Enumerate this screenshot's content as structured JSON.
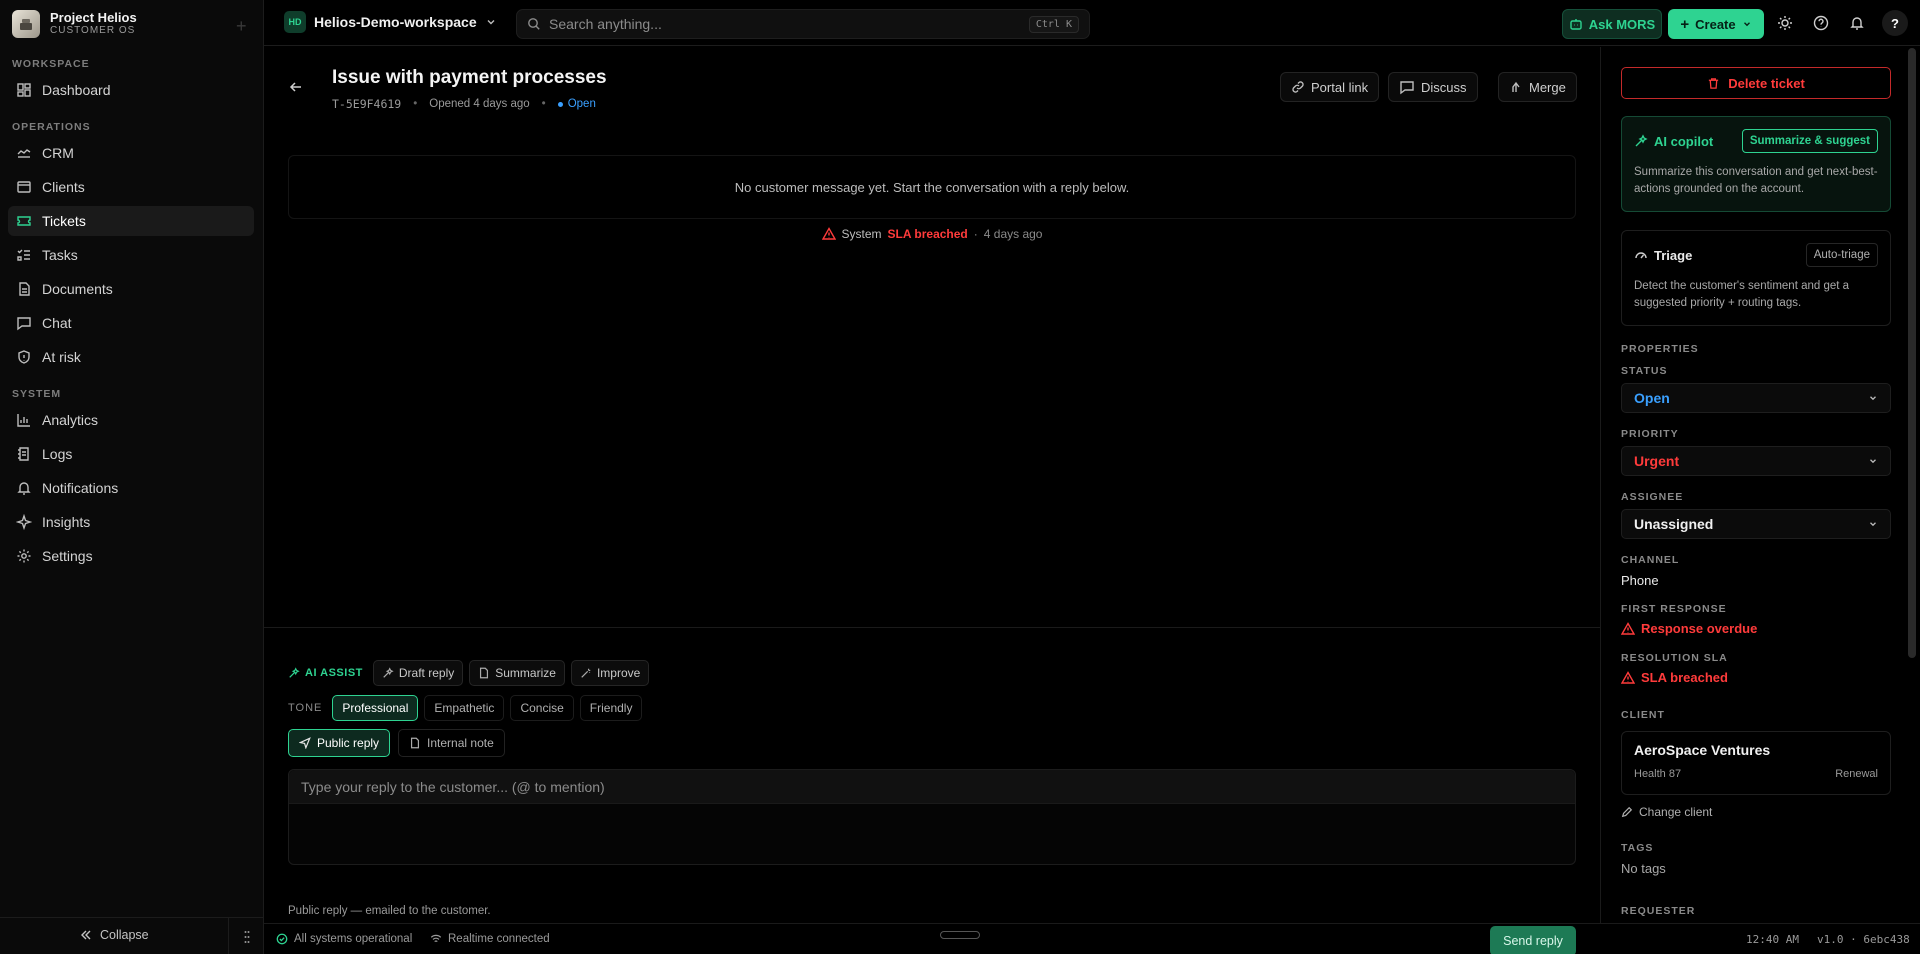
{
  "app": {
    "name": "Project Helios",
    "subtitle": "CUSTOMER OS"
  },
  "sidebar": {
    "sections": [
      "WORKSPACE",
      "OPERATIONS",
      "SYSTEM"
    ],
    "items": [
      {
        "label": "Dashboard",
        "icon": "dashboard-icon"
      },
      {
        "label": "CRM",
        "icon": "crm-icon"
      },
      {
        "label": "Clients",
        "icon": "users-icon"
      },
      {
        "label": "Tickets",
        "icon": "ticket-icon"
      },
      {
        "label": "Tasks",
        "icon": "tasks-icon"
      },
      {
        "label": "Documents",
        "icon": "document-icon"
      },
      {
        "label": "Chat",
        "icon": "chat-icon"
      },
      {
        "label": "At risk",
        "icon": "shield-icon"
      },
      {
        "label": "Analytics",
        "icon": "analytics-icon"
      },
      {
        "label": "Logs",
        "icon": "logs-icon"
      },
      {
        "label": "Notifications",
        "icon": "bell-icon"
      },
      {
        "label": "Insights",
        "icon": "sparkle-icon"
      },
      {
        "label": "Settings",
        "icon": "gear-icon"
      }
    ],
    "active": "Tickets",
    "collapse_label": "Collapse"
  },
  "topbar": {
    "workspace_badge": "HD",
    "workspace_name": "Helios-Demo-workspace",
    "search_placeholder": "Search anything...",
    "search_shortcut": "Ctrl K",
    "ask_label": "Ask MORS",
    "create_label": "Create",
    "help_label": "?"
  },
  "ticket": {
    "title": "Issue with payment processes",
    "id": "T-5E9F4619",
    "opened": "Opened 4 days ago",
    "status": "Open",
    "actions": {
      "portal": "Portal link",
      "discuss": "Discuss",
      "merge": "Merge"
    },
    "empty_message": "No customer message yet. Start the conversation with a reply below.",
    "event": {
      "actor": "System",
      "text": "SLA breached",
      "sep": "·",
      "time": "4 days ago"
    }
  },
  "composer": {
    "ai_label": "AI ASSIST",
    "ai_actions": [
      "Draft reply",
      "Summarize",
      "Improve"
    ],
    "tone_label": "TONE",
    "tones": [
      "Professional",
      "Empathetic",
      "Concise",
      "Friendly"
    ],
    "active_tone": "Professional",
    "modes": [
      "Public reply",
      "Internal note"
    ],
    "placeholder": "Type your reply to the customer... (@ to mention)",
    "note": "Public reply — emailed to the customer.",
    "send_label": "Send reply"
  },
  "right": {
    "delete_label": "Delete ticket",
    "copilot": {
      "title": "AI copilot",
      "button": "Summarize & suggest",
      "text": "Summarize this conversation and get next-best-actions grounded on the account."
    },
    "triage": {
      "title": "Triage",
      "button": "Auto-triage",
      "text": "Detect the customer's sentiment and get a suggested priority + routing tags."
    },
    "properties_label": "PROPERTIES",
    "status_label": "STATUS",
    "status_value": "Open",
    "priority_label": "PRIORITY",
    "priority_value": "Urgent",
    "assignee_label": "ASSIGNEE",
    "assignee_value": "Unassigned",
    "channel_label": "CHANNEL",
    "channel_value": "Phone",
    "first_response_label": "FIRST RESPONSE",
    "first_response_value": "Response overdue",
    "resolution_label": "RESOLUTION SLA",
    "resolution_value": "SLA breached",
    "client_label": "CLIENT",
    "client": {
      "name": "AeroSpace Ventures",
      "health": "Health 87",
      "stage": "Renewal"
    },
    "change_client": "Change client",
    "tags_label": "TAGS",
    "tags_value": "No tags",
    "requester_label": "REQUESTER"
  },
  "footer": {
    "status": "All systems operational",
    "realtime": "Realtime connected",
    "time": "12:40 AM",
    "version": "v1.0 · 6ebc438"
  },
  "colors": {
    "accent": "#2ed391",
    "danger": "#ff3b3b",
    "info": "#3aa0ff"
  }
}
